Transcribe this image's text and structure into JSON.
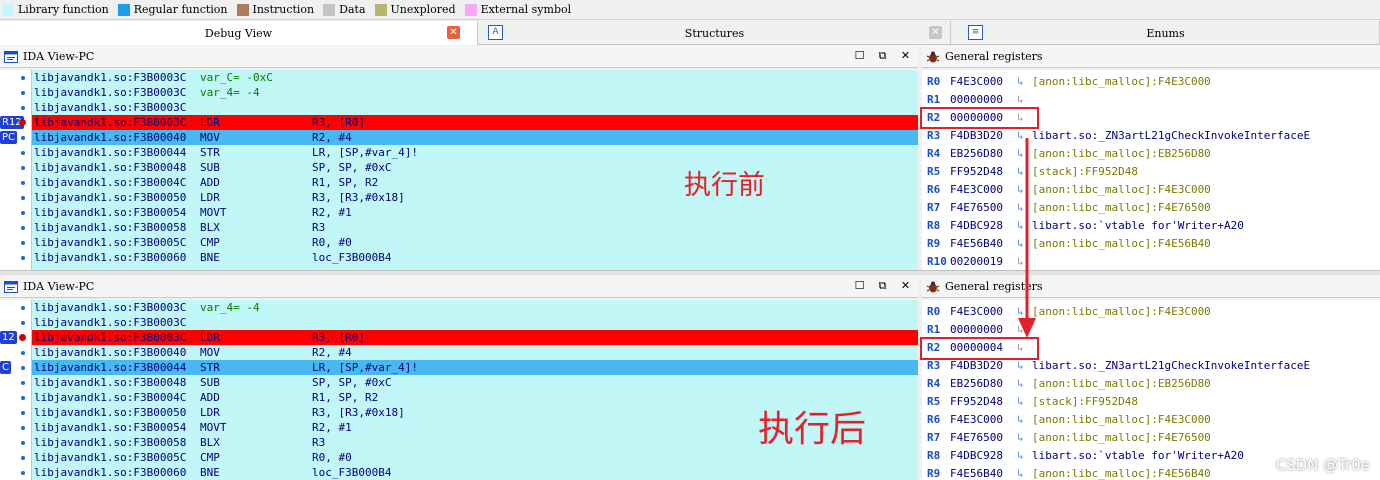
{
  "legend": [
    {
      "label": "Library function",
      "color": "#c6f6f8"
    },
    {
      "label": "Regular function",
      "color": "#1aa0e8"
    },
    {
      "label": "Instruction",
      "color": "#b07b5c"
    },
    {
      "label": "Data",
      "color": "#c4c4c4"
    },
    {
      "label": "Unexplored",
      "color": "#b5b56e"
    },
    {
      "label": "External symbol",
      "color": "#f8a6f8"
    }
  ],
  "tabs": {
    "debug_view": "Debug View",
    "structures": "Structures",
    "enums": "Enums",
    "structures_icon": "A",
    "enums_icon": "≡"
  },
  "top": {
    "ida_title": "IDA View-PC",
    "regs_title": "General registers",
    "gutter_labels": [
      "R12",
      "PC"
    ],
    "code": [
      {
        "addr": "libjavandk1.so:F3B0003C",
        "mn": "",
        "var": "var_C= -0xC",
        "op": ""
      },
      {
        "addr": "libjavandk1.so:F3B0003C",
        "mn": "",
        "var": "var_4= -4",
        "op": ""
      },
      {
        "addr": "libjavandk1.so:F3B0003C",
        "mn": "",
        "var": "",
        "op": ""
      },
      {
        "addr": "libjavandk1.so:F3B0003C",
        "mn": "LDR",
        "var": "",
        "op": "R3, [R0]",
        "hl": "red"
      },
      {
        "addr": "libjavandk1.so:F3B00040",
        "mn": "MOV",
        "var": "",
        "op": "R2, #4",
        "hl": "blue"
      },
      {
        "addr": "libjavandk1.so:F3B00044",
        "mn": "STR",
        "var": "",
        "op": "LR, [SP,#var_4]!"
      },
      {
        "addr": "libjavandk1.so:F3B00048",
        "mn": "SUB",
        "var": "",
        "op": "SP, SP, #0xC"
      },
      {
        "addr": "libjavandk1.so:F3B0004C",
        "mn": "ADD",
        "var": "",
        "op": "R1, SP, R2"
      },
      {
        "addr": "libjavandk1.so:F3B00050",
        "mn": "LDR",
        "var": "",
        "op": "R3, [R3,#0x18]"
      },
      {
        "addr": "libjavandk1.so:F3B00054",
        "mn": "MOVT",
        "var": "",
        "op": "R2, #1"
      },
      {
        "addr": "libjavandk1.so:F3B00058",
        "mn": "BLX",
        "var": "",
        "op": "R3"
      },
      {
        "addr": "libjavandk1.so:F3B0005C",
        "mn": "CMP",
        "var": "",
        "op": "R0, #0"
      },
      {
        "addr": "libjavandk1.so:F3B00060",
        "mn": "BNE",
        "var": "",
        "op": "loc_F3B000B4"
      }
    ],
    "regs": [
      {
        "name": "R0",
        "value": "F4E3C000",
        "arrow": "active",
        "desc": "[anon:libc_malloc]:F4E3C000"
      },
      {
        "name": "R1",
        "value": "00000000",
        "arrow": "grey",
        "desc": ""
      },
      {
        "name": "R2",
        "value": "00000000",
        "arrow": "grey",
        "desc": ""
      },
      {
        "name": "R3",
        "value": "F4DB3D20",
        "arrow": "active",
        "desc": "libart.so:_ZN3artL21gCheckInvokeInterfaceE"
      },
      {
        "name": "R4",
        "value": "EB256D80",
        "arrow": "active",
        "desc": "[anon:libc_malloc]:EB256D80"
      },
      {
        "name": "R5",
        "value": "FF952D48",
        "arrow": "active",
        "desc": "[stack]:FF952D48"
      },
      {
        "name": "R6",
        "value": "F4E3C000",
        "arrow": "active",
        "desc": "[anon:libc_malloc]:F4E3C000"
      },
      {
        "name": "R7",
        "value": "F4E76500",
        "arrow": "active",
        "desc": "[anon:libc_malloc]:F4E76500"
      },
      {
        "name": "R8",
        "value": "F4DBC928",
        "arrow": "active",
        "desc": "libart.so:`vtable for'Writer+A20"
      },
      {
        "name": "R9",
        "value": "F4E56B40",
        "arrow": "active",
        "desc": "[anon:libc_malloc]:F4E56B40"
      },
      {
        "name": "R10",
        "value": "00200019",
        "arrow": "grey",
        "desc": ""
      }
    ]
  },
  "bottom": {
    "ida_title": "IDA View-PC",
    "regs_title": "General registers",
    "gutter_labels": [
      "12",
      "C"
    ],
    "code": [
      {
        "addr": "libjavandk1.so:F3B0003C",
        "mn": "",
        "var": "var_4= -4",
        "op": ""
      },
      {
        "addr": "libjavandk1.so:F3B0003C",
        "mn": "",
        "var": "",
        "op": ""
      },
      {
        "addr": "libjavandk1.so:F3B0003C",
        "mn": "LDR",
        "var": "",
        "op": "R3, [R0]",
        "hl": "red"
      },
      {
        "addr": "libjavandk1.so:F3B00040",
        "mn": "MOV",
        "var": "",
        "op": "R2, #4"
      },
      {
        "addr": "libjavandk1.so:F3B00044",
        "mn": "STR",
        "var": "",
        "op": "LR, [SP,#var_4]!",
        "hl": "blue"
      },
      {
        "addr": "libjavandk1.so:F3B00048",
        "mn": "SUB",
        "var": "",
        "op": "SP, SP, #0xC"
      },
      {
        "addr": "libjavandk1.so:F3B0004C",
        "mn": "ADD",
        "var": "",
        "op": "R1, SP, R2"
      },
      {
        "addr": "libjavandk1.so:F3B00050",
        "mn": "LDR",
        "var": "",
        "op": "R3, [R3,#0x18]"
      },
      {
        "addr": "libjavandk1.so:F3B00054",
        "mn": "MOVT",
        "var": "",
        "op": "R2, #1"
      },
      {
        "addr": "libjavandk1.so:F3B00058",
        "mn": "BLX",
        "var": "",
        "op": "R3"
      },
      {
        "addr": "libjavandk1.so:F3B0005C",
        "mn": "CMP",
        "var": "",
        "op": "R0, #0"
      },
      {
        "addr": "libjavandk1.so:F3B00060",
        "mn": "BNE",
        "var": "",
        "op": "loc_F3B000B4"
      }
    ],
    "regs": [
      {
        "name": "R0",
        "value": "F4E3C000",
        "arrow": "active",
        "desc": "[anon:libc_malloc]:F4E3C000"
      },
      {
        "name": "R1",
        "value": "00000000",
        "arrow": "grey",
        "desc": ""
      },
      {
        "name": "R2",
        "value": "00000004",
        "arrow": "grey",
        "desc": ""
      },
      {
        "name": "R3",
        "value": "F4DB3D20",
        "arrow": "active",
        "desc": "libart.so:_ZN3artL21gCheckInvokeInterfaceE"
      },
      {
        "name": "R4",
        "value": "EB256D80",
        "arrow": "active",
        "desc": "[anon:libc_malloc]:EB256D80"
      },
      {
        "name": "R5",
        "value": "FF952D48",
        "arrow": "active",
        "desc": "[stack]:FF952D48"
      },
      {
        "name": "R6",
        "value": "F4E3C000",
        "arrow": "active",
        "desc": "[anon:libc_malloc]:F4E3C000"
      },
      {
        "name": "R7",
        "value": "F4E76500",
        "arrow": "active",
        "desc": "[anon:libc_malloc]:F4E76500"
      },
      {
        "name": "R8",
        "value": "F4DBC928",
        "arrow": "active",
        "desc": "libart.so:`vtable for'Writer+A20"
      },
      {
        "name": "R9",
        "value": "F4E56B40",
        "arrow": "active",
        "desc": "[anon:libc_malloc]:F4E56B40"
      }
    ]
  },
  "annotations": {
    "before": "执行前",
    "after": "执行后"
  },
  "watermark": "CSDN @Tr0e",
  "colors": {
    "highlight_red": "#ff0000",
    "highlight_blue": "#49b8f0",
    "code_bg": "#c2f7f7",
    "annotation": "#e8202a"
  },
  "window_controls": {
    "restore": "☐",
    "float": "⧉",
    "close": "✕"
  }
}
